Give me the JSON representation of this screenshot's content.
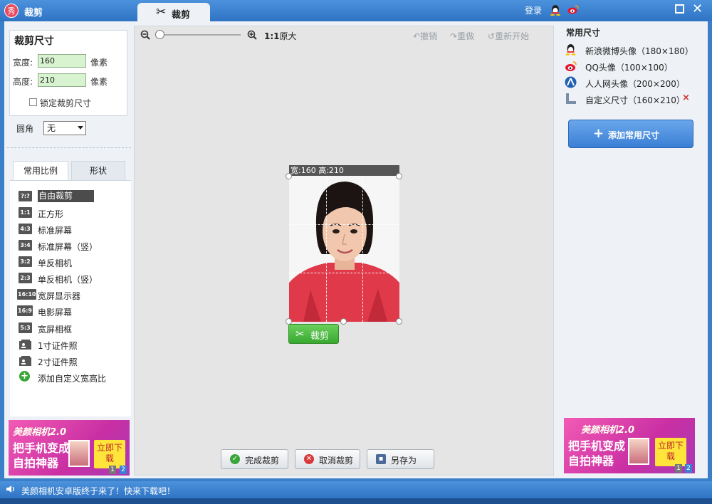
{
  "window": {
    "title": "裁剪",
    "active_tab": "裁剪",
    "login": "登录",
    "icons": [
      "qq-icon",
      "weibo-icon",
      "maximize-icon",
      "close-icon"
    ]
  },
  "left": {
    "size_title": "裁剪尺寸",
    "width_label": "宽度:",
    "width_value": "160",
    "width_unit": "像素",
    "height_label": "高度:",
    "height_value": "210",
    "height_unit": "像素",
    "lock_label": "锁定裁剪尺寸",
    "lock_checked": false,
    "radius_label": "圆角",
    "radius_value": "无",
    "tabs": [
      "常用比例",
      "形状"
    ],
    "ratios": [
      {
        "icon": "?:?",
        "label": "自由裁剪",
        "selected": true
      },
      {
        "icon": "1:1",
        "label": "正方形"
      },
      {
        "icon": "4:3",
        "label": "标准屏幕"
      },
      {
        "icon": "3:4",
        "label": "标准屏幕（竖）"
      },
      {
        "icon": "3:2",
        "label": "单反相机"
      },
      {
        "icon": "2:3",
        "label": "单反相机（竖）"
      },
      {
        "icon": "16:10",
        "label": "宽屏显示器"
      },
      {
        "icon": "16:9",
        "label": "电影屏幕"
      },
      {
        "icon": "5:3",
        "label": "宽屏相框"
      },
      {
        "icon": "id-photo-icon",
        "label": "1寸证件照"
      },
      {
        "icon": "id-photo-icon",
        "label": "2寸证件照"
      },
      {
        "icon": "plus-icon",
        "label": "添加自定义宽高比"
      }
    ]
  },
  "ad": {
    "brand": "美颜相机2.0",
    "slogan1": "把手机变成",
    "slogan2": "自拍神器",
    "button": "立即下载",
    "page1": "1",
    "page2": "2"
  },
  "toolbar": {
    "zoom_label": "1:1",
    "zoom_text": "原大",
    "undo": "撤销",
    "redo": "重做",
    "restart": "重新开始",
    "zoom_level": 0.0
  },
  "canvas": {
    "crop_info": "宽:160 高:210",
    "crop_button": "裁剪"
  },
  "bottom": {
    "done": "完成裁剪",
    "cancel": "取消裁剪",
    "save_as": "另存为"
  },
  "right": {
    "title": "常用尺寸",
    "presets": [
      {
        "icon": "weibo-icon",
        "label": "新浪微博头像（180×180）"
      },
      {
        "icon": "qq-icon",
        "label": "QQ头像（100×100）"
      },
      {
        "icon": "renren-icon",
        "label": "人人网头像（200×200）"
      },
      {
        "icon": "ruler-icon",
        "label": "自定义尺寸（160×210）"
      }
    ],
    "remove": "×",
    "add_button": "添加常用尺寸"
  },
  "status": {
    "text": "美颜相机安卓版终于来了！快来下载吧！"
  },
  "colors": {
    "titlebar": "#3a7fc8",
    "accent_green": "#38a831",
    "accent_blue": "#3a7fd6",
    "field_green": "#d8f3d0"
  }
}
